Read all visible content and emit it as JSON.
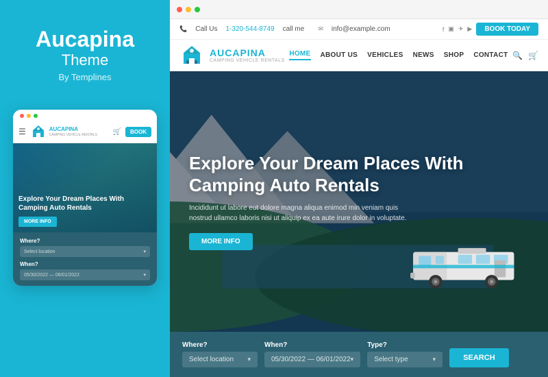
{
  "left": {
    "brand_title": "Aucapina",
    "brand_sub": "Theme",
    "brand_by": "By Templines",
    "mobile": {
      "dots": [
        "red",
        "yellow",
        "green"
      ],
      "logo_name": "AUCAPINA",
      "logo_sub": "CAMPING VEHICLE RENTALS",
      "book_label": "BOOK",
      "hero_title": "Explore Your Dream Places With Camping Auto Rentals",
      "more_info_label": "MORE INFO",
      "form": {
        "where_label": "Where?",
        "where_placeholder": "Select location",
        "when_label": "When?",
        "when_placeholder": "05/30/2022 — 06/01/2022"
      }
    }
  },
  "right": {
    "desktop": {
      "dots": [
        "red",
        "yellow",
        "green"
      ],
      "info_bar": {
        "phone": "1-320-544-8749",
        "call_me": "call me",
        "email": "info@example.com",
        "book_label": "BOOK TODAY"
      },
      "nav": {
        "logo_name": "AUCAPINA",
        "logo_tagline": "CAMPING VEHICLE RENTALS",
        "links": [
          "HOME",
          "ABOUT US",
          "VEHICLES",
          "NEWS",
          "SHOP",
          "CONTACT"
        ],
        "active_link": "HOME"
      },
      "hero": {
        "title": "Explore Your Dream Places With\nCamping Auto Rentals",
        "description": "Incididunt ut labore eut dolore magna aliqua enimod min veniam quis nostrud ullamco laboris nisi ut aliquip ex ea aute irure dolor in voluptate.",
        "more_info_label": "MORE INFO"
      },
      "search": {
        "where_label": "Where?",
        "where_placeholder": "Select location",
        "when_label": "When?",
        "when_placeholder": "05/30/2022 — 06/01/2022",
        "type_label": "Type?",
        "type_placeholder": "Select type",
        "search_label": "SEARCH"
      }
    }
  }
}
